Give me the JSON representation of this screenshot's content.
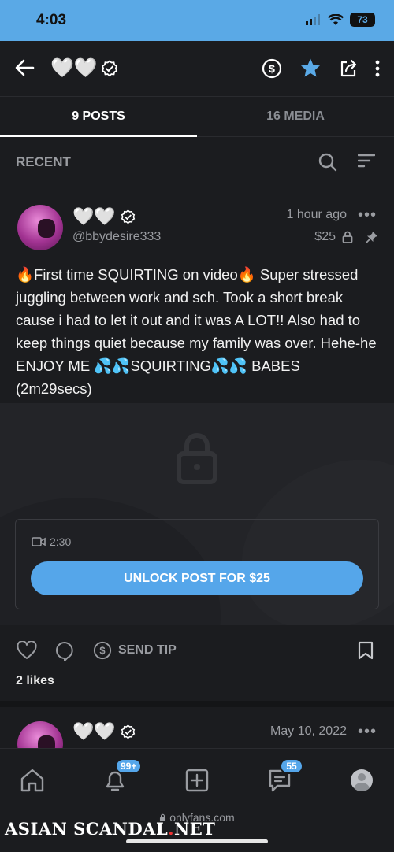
{
  "status": {
    "time": "4:03",
    "battery": "73"
  },
  "header": {
    "name": "🤍🤍",
    "verified_icon": "verified-badge-icon",
    "icons": [
      "back-arrow-icon",
      "dollar-icon",
      "star-icon",
      "share-icon",
      "more-vertical-icon"
    ],
    "accent": "#5aa9e6"
  },
  "tabs": [
    {
      "label": "9 POSTS",
      "active": true
    },
    {
      "label": "16 MEDIA",
      "active": false
    }
  ],
  "section": {
    "title": "RECENT",
    "icons": [
      "search-icon",
      "sort-icon"
    ]
  },
  "post1": {
    "name": "🤍🤍",
    "handle": "@bbydesire333",
    "time": "1 hour ago",
    "more": "•••",
    "price": "$25",
    "text": "🔥First time SQUIRTING on video🔥 Super stressed juggling between work and sch. Took a short break cause i had to let it out and it was A LOT!! Also had to keep things quiet because my family was over. Hehe-he ENJOY ME 💦💦SQUIRTING💦💦 BABES (2m29secs)",
    "video_length": "2:30",
    "unlock_label": "UNLOCK POST FOR $25",
    "send_tip": "SEND TIP",
    "likes": "2 likes"
  },
  "post2": {
    "name": "🤍🤍",
    "time": "May 10, 2022",
    "more": "•••"
  },
  "tabbar": {
    "notifications_badge": "99+",
    "messages_badge": "55"
  },
  "browser": {
    "url": "onlyfans.com"
  },
  "watermark": {
    "part1": "ASIAN SCANDAL",
    "dot": ".",
    "part2": "NET"
  }
}
